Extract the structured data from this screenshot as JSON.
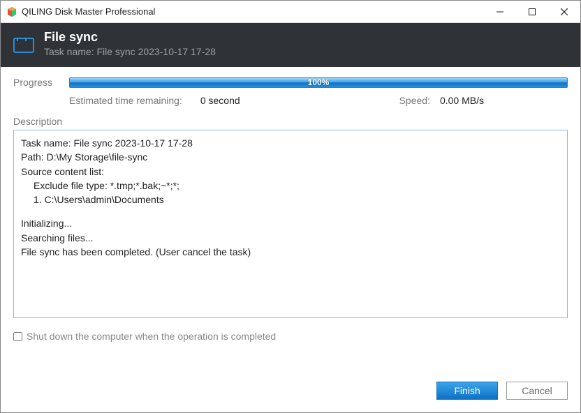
{
  "titlebar": {
    "title": "QILING Disk Master Professional"
  },
  "header": {
    "title": "File sync",
    "subtitle": "Task name: File sync 2023-10-17 17-28"
  },
  "progress": {
    "label": "Progress",
    "percent_text": "100%",
    "estimated_label": "Estimated time remaining:",
    "estimated_value": "0 second",
    "speed_label": "Speed:",
    "speed_value": "0.00 MB/s"
  },
  "description": {
    "label": "Description",
    "line1": "Task name: File sync 2023-10-17 17-28",
    "line2": "Path: D:\\My Storage\\file-sync",
    "line3": "Source content list:",
    "line4": "Exclude file type: *.tmp;*.bak;~*;*;",
    "line5": "1. C:\\Users\\admin\\Documents",
    "line6": "Initializing...",
    "line7": "Searching files...",
    "line8": "File sync has been completed. (User cancel the task)"
  },
  "shutdown": {
    "label": "Shut down the computer when the operation is completed",
    "checked": false
  },
  "buttons": {
    "finish": "Finish",
    "cancel": "Cancel"
  }
}
